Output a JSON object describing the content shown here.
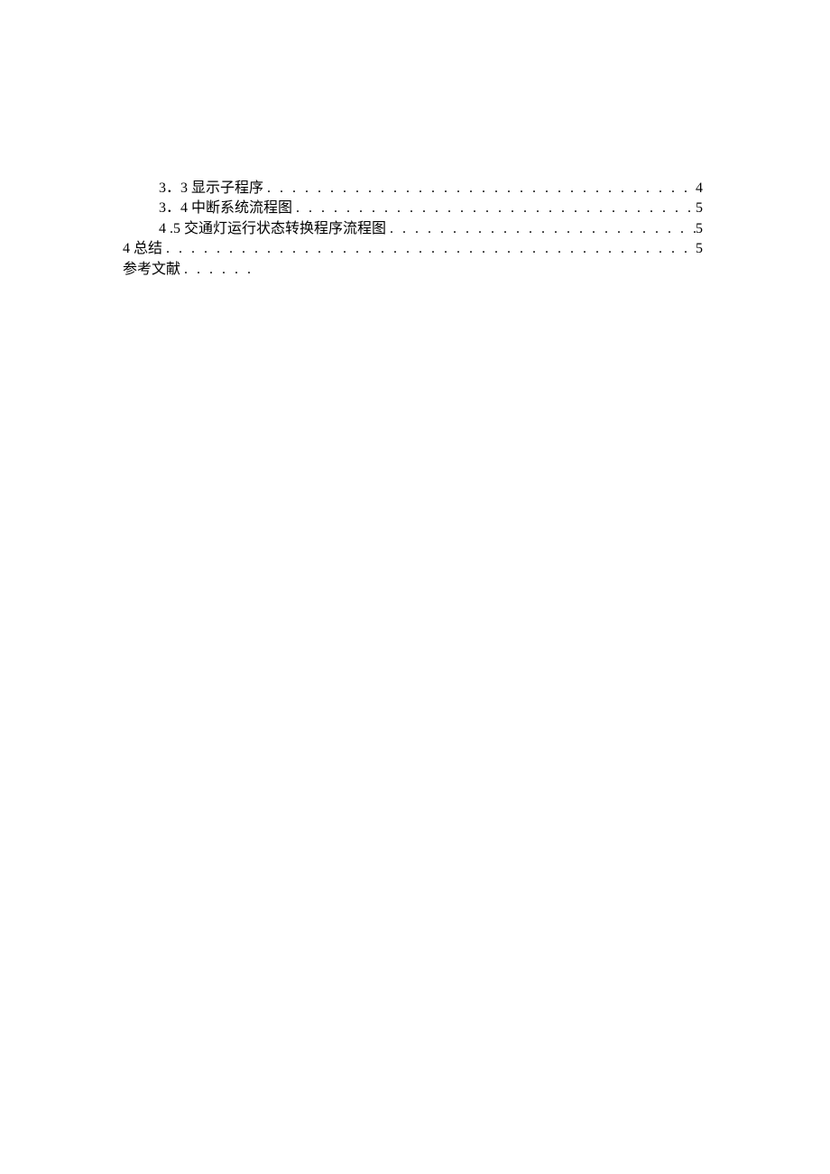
{
  "toc": {
    "entries": [
      {
        "label": "3．3 显示子程序",
        "page": "4",
        "indent": true
      },
      {
        "label": "3．4 中断系统流程图",
        "page": "5",
        "indent": true
      },
      {
        "label": "4  .5 交通灯运行状态转换程序流程图",
        "page": "5",
        "indent": true
      },
      {
        "label": "4 总结",
        "page": "5",
        "indent": false
      }
    ],
    "trailing": {
      "label": "参考文献",
      "dots": ". . . . . ."
    }
  }
}
